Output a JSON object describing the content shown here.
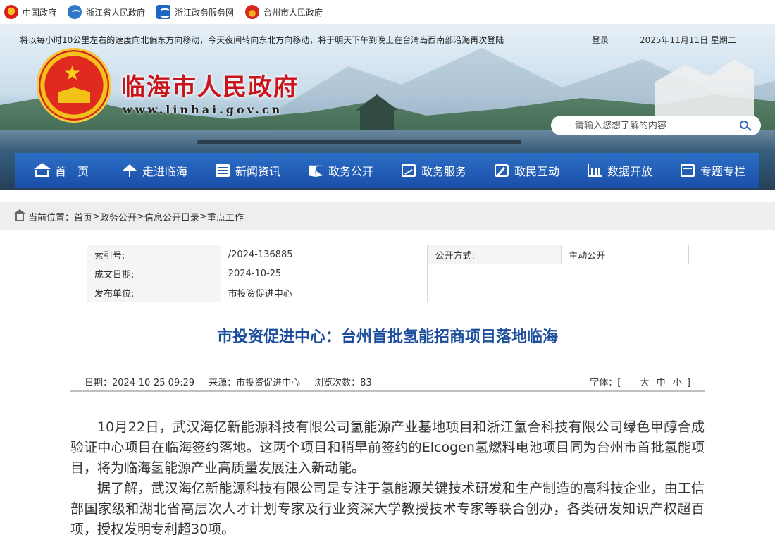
{
  "topbar": {
    "links": [
      {
        "label": "中国政府",
        "icon": "national-emblem-icon"
      },
      {
        "label": "浙江省人民政府",
        "icon": "zhejiang-logo-icon"
      },
      {
        "label": "浙江政务服务网",
        "icon": "service-net-icon"
      },
      {
        "label": "台州市人民政府",
        "icon": "taizhou-logo-icon"
      }
    ]
  },
  "header": {
    "notice": "将以每小时10公里左右的速度向北偏东方向移动，今天夜间转向东北方向移动，将于明天下午到晚上在台湾岛西南部沿海再次登陆",
    "login": "登录",
    "date": "2025年11月11日 星期二",
    "site_title": "临海市人民政府",
    "site_domain": "www.linhai.gov.cn",
    "search_placeholder": "请输入您想了解的内容"
  },
  "nav": [
    {
      "label": "首　页",
      "icon": "home-icon"
    },
    {
      "label": "走进临海",
      "icon": "palm-tree-icon"
    },
    {
      "label": "新闻资讯",
      "icon": "news-icon"
    },
    {
      "label": "政务公开",
      "icon": "open-book-icon"
    },
    {
      "label": "政务服务",
      "icon": "service-chart-icon"
    },
    {
      "label": "政民互动",
      "icon": "edit-icon"
    },
    {
      "label": "数据开放",
      "icon": "bar-chart-icon"
    },
    {
      "label": "专题专栏",
      "icon": "calendar-icon"
    }
  ],
  "breadcrumb": {
    "prefix": "当前位置：",
    "items": [
      "首页",
      "政务公开",
      "信息公开目录",
      "重点工作"
    ],
    "separator": ">"
  },
  "meta": {
    "index_label": "索引号:",
    "index_value": "/2024-136885",
    "open_label": "公开方式:",
    "open_value": "主动公开",
    "date_label": "成文日期:",
    "date_value": "2024-10-25",
    "unit_label": "发布单位:",
    "unit_value": "市投资促进中心"
  },
  "article": {
    "title": "市投资促进中心：台州首批氢能招商项目落地临海",
    "date": "日期：2024-10-25 09:29",
    "source": "来源：市投资促进中心",
    "views": "浏览次数：83",
    "fontsize_label": "字体：[",
    "fontsize_big": "大",
    "fontsize_mid": "中",
    "fontsize_small": "小",
    "fontsize_end": "]",
    "paragraphs": [
      "10月22日，武汉海亿新能源科技有限公司氢能源产业基地项目和浙江氢合科技有限公司绿色甲醇合成验证中心项目在临海签约落地。这两个项目和稍早前签约的Elcogen氢燃料电池项目同为台州市首批氢能项目，将为临海氢能源产业高质量发展注入新动能。",
      "据了解，武汉海亿新能源科技有限公司是专注于氢能源关键技术研发和生产制造的高科技企业，由工信部国家级和湖北省高层次人才计划专家及行业资深大学教授技术专家等联合创办，各类研发知识产权超百项，授权发明专利超30项。"
    ]
  },
  "colors": {
    "title_red": "#c8141b",
    "nav_blue": "#1f5bb4",
    "article_title_blue": "#1d4f9c"
  }
}
